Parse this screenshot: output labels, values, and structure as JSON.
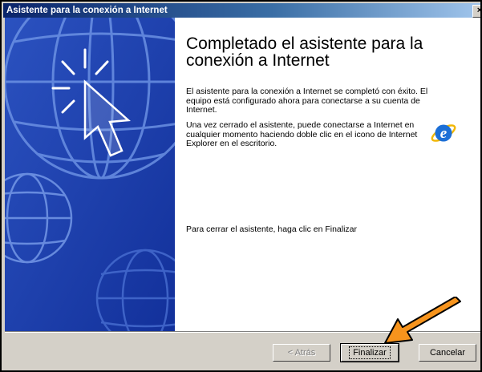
{
  "window": {
    "title": "Asistente para la conexión a Internet",
    "close_glyph": "×"
  },
  "content": {
    "heading": "Completado el asistente para la conexión a Internet",
    "paragraph1": "El asistente para la conexión a Internet se completó con éxito. El equipo está configurado ahora para conectarse a su cuenta de Internet.",
    "paragraph2": "Una vez cerrado el asistente, puede conectarse a Internet en cualquier momento haciendo doble clic en el icono de Internet Explorer en el escritorio.",
    "paragraph3": "Para cerrar el asistente, haga clic en Finalizar",
    "ie_icon": "internet-explorer-icon"
  },
  "buttons": {
    "back": "< Atrás",
    "finish": "Finalizar",
    "cancel": "Cancelar"
  },
  "colors": {
    "title_bar": "#0a246a",
    "left_panel": "#1e3fa8",
    "arrow": "#f7941d",
    "window_face": "#d4d0c8"
  },
  "annotation": {
    "icon": "orange-arrow-icon"
  }
}
